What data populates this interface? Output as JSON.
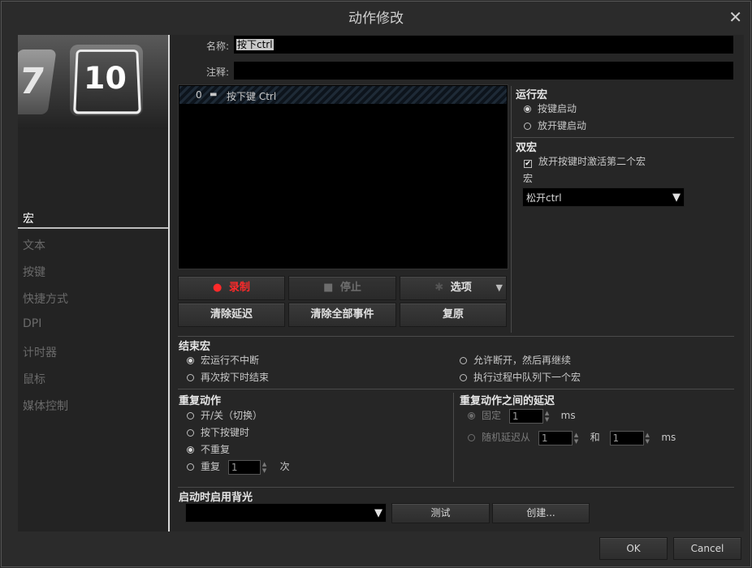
{
  "window": {
    "title": "动作修改"
  },
  "sidebar": {
    "thumbnail": {
      "key_left": "7",
      "key_right": "10"
    },
    "items": [
      {
        "label": "宏"
      },
      {
        "label": "文本"
      },
      {
        "label": "按键"
      },
      {
        "label": "快捷方式"
      },
      {
        "label": "DPI"
      },
      {
        "label": "计时器"
      },
      {
        "label": "鼠标"
      },
      {
        "label": "媒体控制"
      }
    ]
  },
  "form": {
    "name_label": "名称:",
    "name_value": "按下ctrl",
    "comment_label": "注释:",
    "comment_value": ""
  },
  "event_list": {
    "rows": [
      {
        "index": "0",
        "text": "按下键 Ctrl"
      }
    ]
  },
  "controls": {
    "record": "录制",
    "stop": "停止",
    "options": "选项",
    "clear_delay": "清除延迟",
    "clear_all": "清除全部事件",
    "restore": "复原"
  },
  "run_macro": {
    "title": "运行宏",
    "opt_press": "按键启动",
    "opt_release": "放开键启动"
  },
  "double_macro": {
    "title": "双宏",
    "check_label": "放开按键时激活第二个宏",
    "macro_label": "宏",
    "macro_value": "松开ctrl"
  },
  "end_macro": {
    "title": "结束宏",
    "opt1": "宏运行不中断",
    "opt2": "允许断开，然后再继续",
    "opt3": "再次按下时结束",
    "opt4": "执行过程中队列下一个宏"
  },
  "repeat": {
    "title": "重复动作",
    "opt_toggle": "开/关（切换）",
    "opt_hold": "按下按键时",
    "opt_none": "不重复",
    "opt_repeat": "重复",
    "repeat_count": "1",
    "times_unit": "次"
  },
  "repeat_delay": {
    "title": "重复动作之间的延迟",
    "opt_fixed": "固定",
    "fixed_value": "1",
    "ms": "ms",
    "opt_random": "随机延迟从",
    "random_from": "1",
    "and_label": "和",
    "random_to": "1"
  },
  "backlight": {
    "title": "启动时启用背光",
    "select_value": "",
    "test": "测试",
    "create": "创建..."
  },
  "footer": {
    "ok": "OK",
    "cancel": "Cancel"
  },
  "colors": {
    "record_red": "#ff2a2a",
    "panel_bg": "#262626",
    "list_bg": "#000000"
  }
}
